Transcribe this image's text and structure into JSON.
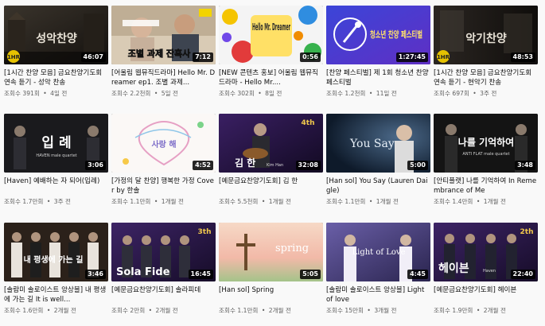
{
  "videos": [
    {
      "thumb_text": "성악찬양",
      "badge": "1HR",
      "duration": "46:07",
      "title": "[1시간 찬양 모음] 금요찬양기도회 연속 듣기 - 성악 찬송",
      "views": "조회수 391회",
      "age": "4일 전"
    },
    {
      "thumb_text": "조별 과제 잔혹사",
      "badge": "",
      "duration": "7:12",
      "title": "[어울림 웹뮤직드라마] Hello Mr. Dreamer ep1. 조별 과제...",
      "views": "조회수 2.2천회",
      "age": "5일 전"
    },
    {
      "thumb_text": "Hello Mr. Dreamer",
      "badge": "",
      "duration": "0:56",
      "title": "[NEW 콘텐츠 홍보] 어울림 웹뮤직드라마 - Hello Mr....",
      "views": "조회수 302회",
      "age": "8일 전"
    },
    {
      "thumb_text": "청소년 찬양 페스티벌",
      "badge": "",
      "duration": "1:27:45",
      "title": "[찬양 페스티벌] 제 1회 청소년 찬양 페스티벌",
      "views": "조회수 1.2천회",
      "age": "11일 전"
    },
    {
      "thumb_text": "악기찬양",
      "badge": "1HR",
      "duration": "48:53",
      "title": "[1시간 찬양 모음] 금요찬양기도회 연속 듣기 - 현악기 찬송",
      "views": "조회수 697회",
      "age": "3주 전"
    },
    {
      "thumb_text": "입 례",
      "subtext": "HAVEN male quartet",
      "badge": "",
      "duration": "3:06",
      "title": "[Haven] 예배하는 자 되어(입례)",
      "views": "조회수 1.7만회",
      "age": "3주 전"
    },
    {
      "thumb_text": "사랑 해",
      "badge": "",
      "duration": "4:52",
      "title": "[가정의 달 찬양] 행복한 가정 Cover by 한솔",
      "views": "조회수 1.1만회",
      "age": "1개월 전"
    },
    {
      "thumb_text": "김 한",
      "subtext": "Kim Han",
      "badge": "4th",
      "duration": "32:08",
      "title": "[예문금요찬양기도회] 김 한",
      "views": "조회수 5.5천회",
      "age": "1개월 전"
    },
    {
      "thumb_text": "You Say",
      "badge": "",
      "duration": "5:00",
      "title": "[Han sol] You Say (Lauren Daigle)",
      "views": "조회수 1.1만회",
      "age": "1개월 전"
    },
    {
      "thumb_text": "나를 기억하여",
      "subtext": "ANTI FLAT male quartet",
      "badge": "",
      "duration": "3:48",
      "title": "[안티플랫] 나를 기억하여 In Remembrance of Me",
      "views": "조회수 1.4만회",
      "age": "1개월 전"
    },
    {
      "thumb_text": "내 평생에 가는 길",
      "badge": "",
      "duration": "3:46",
      "title": "[솔람미 솔로이스트 앙상블] 내 평생에 가는 길 It is well...",
      "views": "조회수 1.6만회",
      "age": "2개월 전"
    },
    {
      "thumb_text": "Sola Fide",
      "badge": "3th",
      "duration": "16:45",
      "title": "[예문금요찬양기도회] 솔라피데",
      "views": "조회수 2만회",
      "age": "2개월 전"
    },
    {
      "thumb_text": "spring",
      "badge": "",
      "duration": "5:05",
      "title": "[Han sol] Spring",
      "views": "조회수 1.1만회",
      "age": "2개월 전"
    },
    {
      "thumb_text": "Light of Love",
      "badge": "",
      "duration": "4:45",
      "title": "[솔람미 솔로이스트 앙상블] Light of love",
      "views": "조회수 15만회",
      "age": "3개월 전"
    },
    {
      "thumb_text": "헤이븐",
      "subtext": "Haven",
      "badge": "2th",
      "duration": "22:40",
      "title": "[예문금요찬양기도회] 헤이븐",
      "views": "조회수 1.9만회",
      "age": "2개월 전"
    }
  ],
  "colors": {
    "page_bg": "#f9f9f9",
    "meta_text": "#606060",
    "duration_bg": "#000000"
  }
}
